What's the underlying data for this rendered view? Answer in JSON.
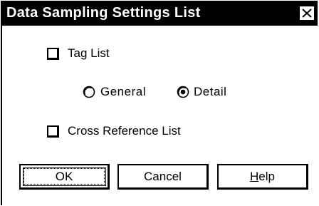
{
  "dialog": {
    "title": "Data Sampling Settings List",
    "close_symbol": "close-icon"
  },
  "options": {
    "tag_list": {
      "label": "Tag List",
      "checked": false
    },
    "radio_general": {
      "label": "General",
      "selected": false
    },
    "radio_detail": {
      "label": "Detail",
      "selected": true
    },
    "cross_reference": {
      "label": "Cross Reference List",
      "checked": false
    }
  },
  "buttons": {
    "ok": "OK",
    "cancel": "Cancel",
    "help_prefix": "H",
    "help_rest": "elp"
  }
}
